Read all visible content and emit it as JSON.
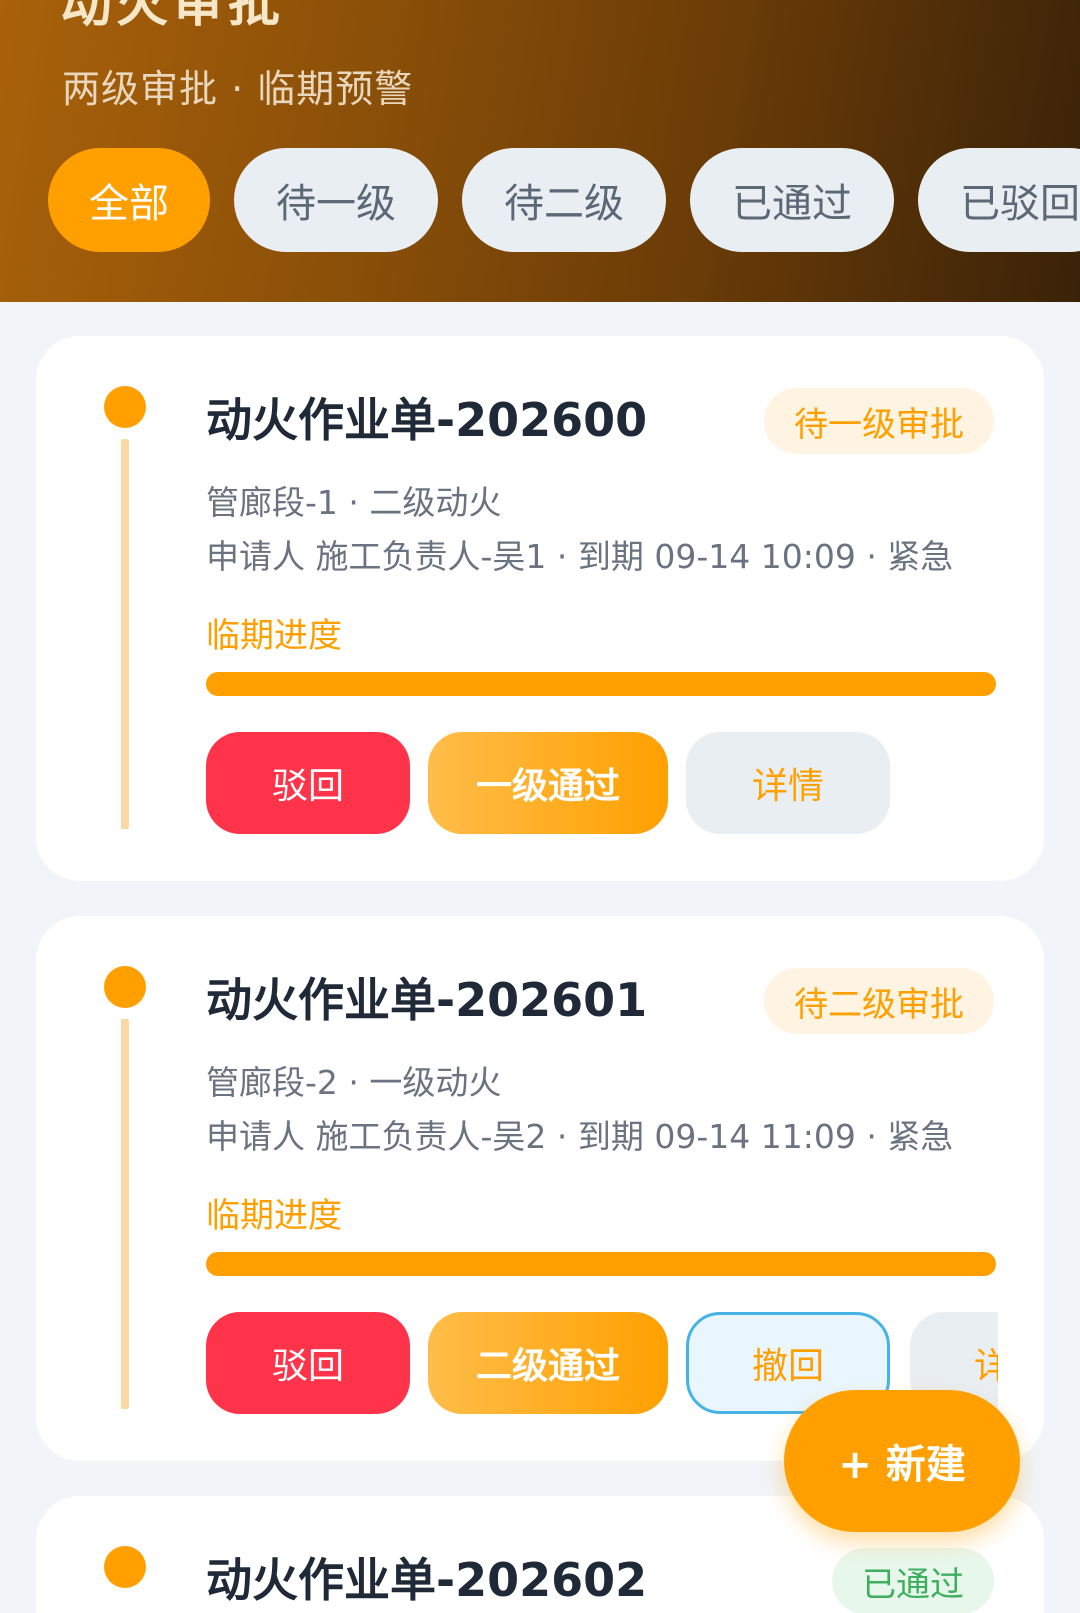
{
  "header": {
    "title": "动火审批",
    "subtitle": "两级审批 · 临期预警"
  },
  "filters": [
    {
      "label": "全部",
      "active": true
    },
    {
      "label": "待一级",
      "active": false
    },
    {
      "label": "待二级",
      "active": false
    },
    {
      "label": "已通过",
      "active": false
    },
    {
      "label": "已驳回",
      "active": false
    }
  ],
  "cards": [
    {
      "title": "动火作业单-202600",
      "status": "待一级审批",
      "location_line": "管廊段-1 · 二级动火",
      "detail_line": "申请人 施工负责人-吴1 · 到期 09-14 10:09 · 紧急",
      "progress_label": "临期进度",
      "progress_fraction": 1.0,
      "actions": {
        "reject": "驳回",
        "approve": "一级通过",
        "detail": "详情"
      }
    },
    {
      "title": "动火作业单-202601",
      "status": "待二级审批",
      "location_line": "管廊段-2 · 一级动火",
      "detail_line": "申请人 施工负责人-吴2 · 到期 09-14 11:09 · 紧急",
      "progress_label": "临期进度",
      "progress_fraction": 1.0,
      "actions": {
        "reject": "驳回",
        "approve": "二级通过",
        "withdraw": "撤回",
        "detail": "详情"
      }
    },
    {
      "title": "动火作业单-202602",
      "status": "已通过"
    }
  ],
  "fab": {
    "label": "+ 新建"
  },
  "colors": {
    "accent": "#ffa000",
    "reject": "#ff3349",
    "passed": "#3fae5f"
  }
}
